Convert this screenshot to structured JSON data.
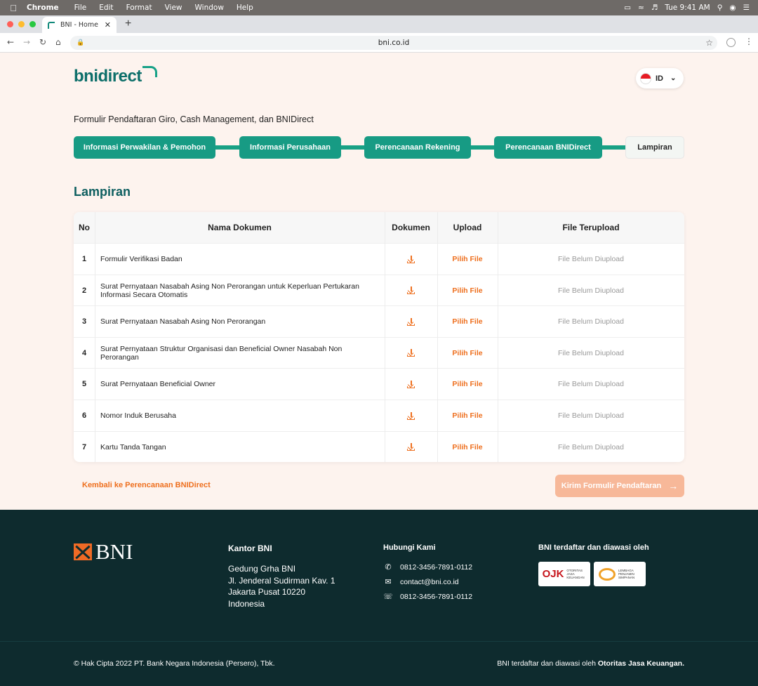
{
  "menubar": {
    "app": "Chrome",
    "items": [
      "File",
      "Edit",
      "Format",
      "View",
      "Window",
      "Help"
    ],
    "clock": "Tue 9:41 AM"
  },
  "browser": {
    "tab_title": "BNI  -  Home",
    "url": "bni.co.id"
  },
  "header": {
    "logo_text": "bnidirect",
    "lang_code": "ID"
  },
  "form": {
    "title": "Formulir Pendaftaran Giro, Cash Management, dan BNIDirect",
    "steps": [
      "Informasi Perwakilan & Pemohon",
      "Informasi Perusahaan",
      "Perencanaan Rekening",
      "Perencanaan BNIDirect",
      "Lampiran"
    ],
    "current_step": 5
  },
  "attachments": {
    "title": "Lampiran",
    "columns": [
      "No",
      "Nama Dokumen",
      "Dokumen",
      "Upload",
      "File Terupload"
    ],
    "upload_label": "Pilih File",
    "status_label": "File Belum Diupload",
    "rows": [
      {
        "no": "1",
        "name": "Formulir Verifikasi Badan"
      },
      {
        "no": "2",
        "name": "Surat Pernyataan Nasabah Asing Non Perorangan untuk Keperluan Pertukaran Informasi Secara Otomatis"
      },
      {
        "no": "3",
        "name": "Surat Pernyataan Nasabah Asing Non Perorangan"
      },
      {
        "no": "4",
        "name": "Surat Pernyataan Struktur Organisasi dan Beneficial Owner Nasabah Non Perorangan"
      },
      {
        "no": "5",
        "name": "Surat Pernyataan Beneficial Owner"
      },
      {
        "no": "6",
        "name": "Nomor Induk Berusaha"
      },
      {
        "no": "7",
        "name": "Kartu Tanda Tangan"
      }
    ]
  },
  "actions": {
    "back_label": "Kembali ke Perencanaan BNIDirect",
    "submit_label": "Kirim Formulir Pendaftaran"
  },
  "footer": {
    "brand": "BNI",
    "office_title": "Kantor BNI",
    "office_lines": [
      "Gedung Grha BNI",
      "Jl. Jenderal Sudirman Kav. 1",
      "Jakarta Pusat 10220",
      "Indonesia"
    ],
    "contact_title": "Hubungi Kami",
    "phone": "0812-3456-7891-0112",
    "email": "contact@bni.co.id",
    "whatsapp": "0812-3456-7891-0112",
    "supervised_title": "BNI terdaftar dan diawasi oleh",
    "ojk_logo": "OJK",
    "ojk_caption": "OTORITAS JASA KEUANGAN",
    "lps_caption": "LEMBAGA PENJAMIN SIMPANAN",
    "copyright": "© Hak Cipta 2022 PT. Bank Negara Indonesia (Persero), Tbk.",
    "registered_prefix": "BNI terdaftar dan diawasi oleh ",
    "registered_strong": "Otoritas Jasa Keuangan."
  },
  "colors": {
    "primary_green": "#179b84",
    "accent_orange": "#ee6f1e",
    "footer_bg": "#0e2b2e",
    "page_bg": "#fdf3ee"
  }
}
